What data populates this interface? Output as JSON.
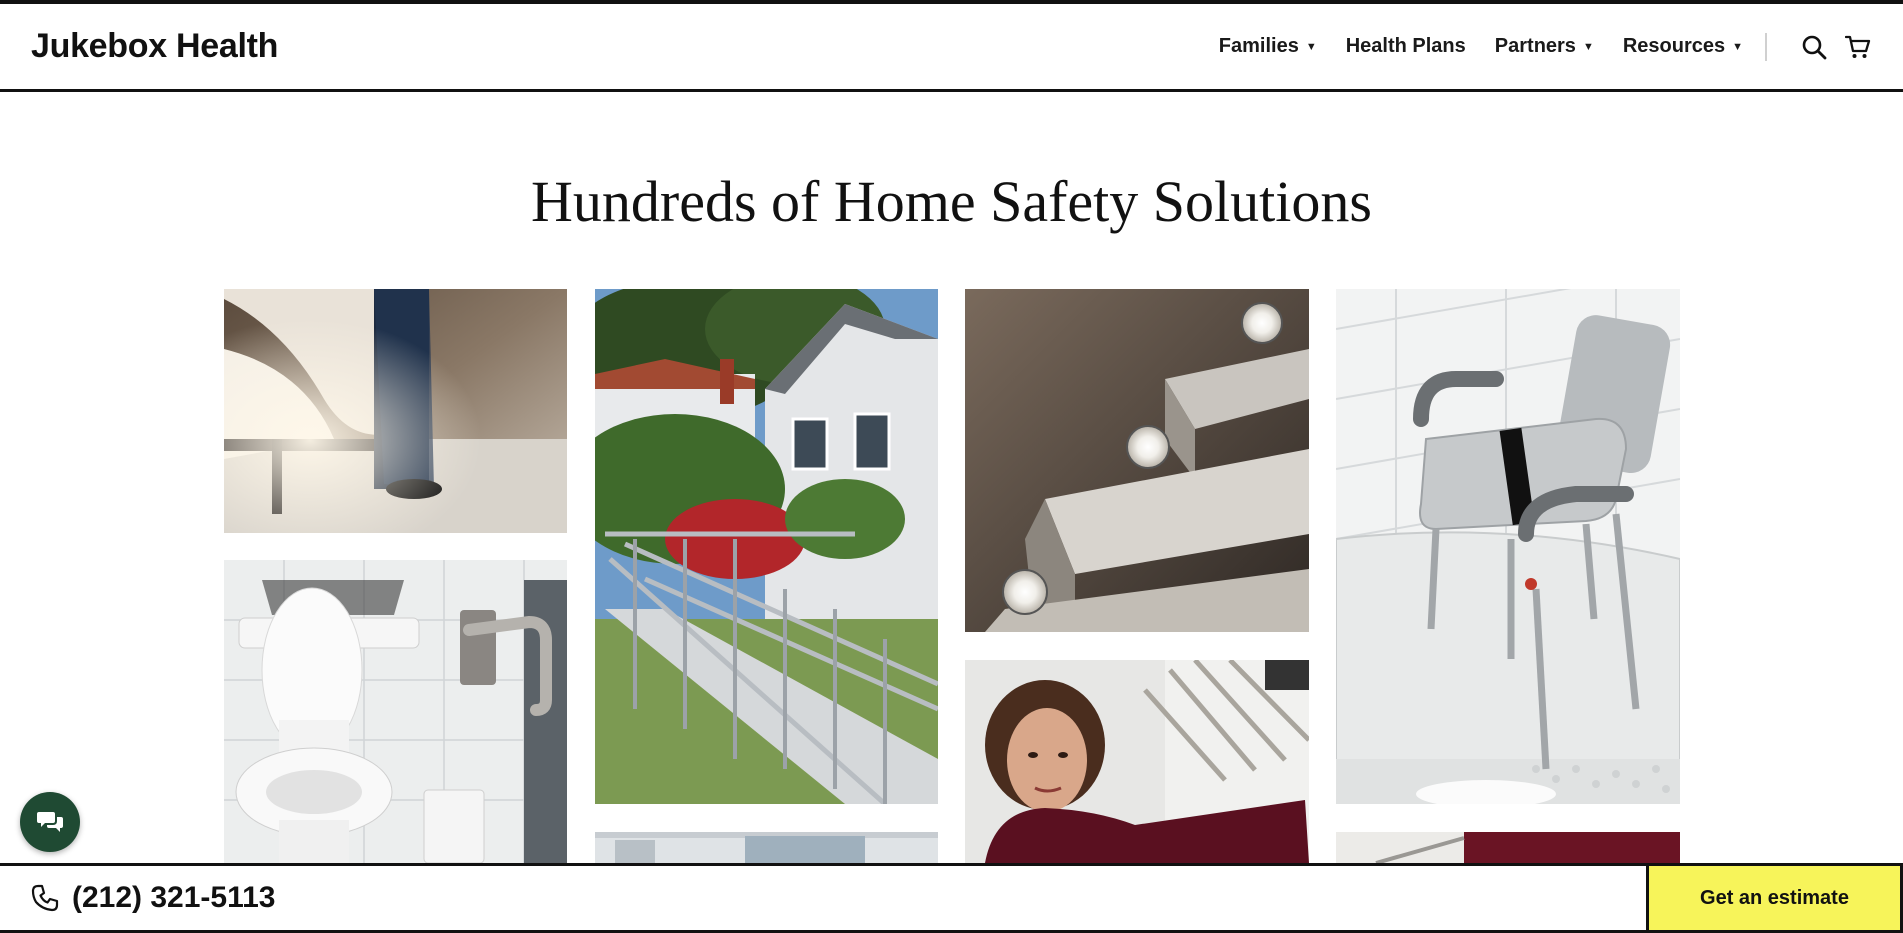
{
  "header": {
    "logo": "Jukebox Health",
    "nav": [
      {
        "label": "Families",
        "dropdown": true
      },
      {
        "label": "Health Plans",
        "dropdown": false
      },
      {
        "label": "Partners",
        "dropdown": true
      },
      {
        "label": "Resources",
        "dropdown": true
      }
    ],
    "icons": [
      "search-icon",
      "cart-icon"
    ]
  },
  "main": {
    "title": "Hundreds of Home Safety Solutions",
    "gallery": [
      {
        "name": "bed-motion-light-photo"
      },
      {
        "name": "toilet-grab-bar-photo"
      },
      {
        "name": "wheelchair-ramp-photo"
      },
      {
        "name": "stair-lights-photo"
      },
      {
        "name": "woman-portrait-photo"
      },
      {
        "name": "shower-transfer-bench-photo"
      }
    ]
  },
  "footer_bar": {
    "phone": "(212) 321-5113",
    "cta": "Get an estimate"
  },
  "colors": {
    "cta_background": "#f7f45a",
    "chat_button": "#1f4a33",
    "border": "#111111"
  }
}
